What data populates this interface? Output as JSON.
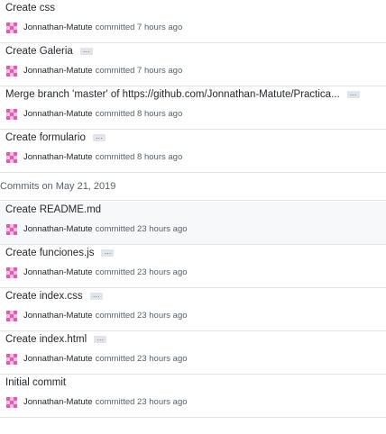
{
  "commits_top": [
    {
      "message": "Create css",
      "ellipsis": false,
      "author": "Jonnathan-Matute",
      "committed": "committed 7 hours ago"
    },
    {
      "message": "Create Galeria",
      "ellipsis": true,
      "author": "Jonnathan-Matute",
      "committed": "committed 7 hours ago"
    },
    {
      "message": "Merge branch 'master' of https://github.com/Jonnathan-Matute/Practica...",
      "ellipsis": true,
      "author": "Jonnathan-Matute",
      "committed": "committed 8 hours ago"
    },
    {
      "message": "Create formulario",
      "ellipsis": true,
      "author": "Jonnathan-Matute",
      "committed": "committed 8 hours ago"
    }
  ],
  "group_header": "Commits on May 21, 2019",
  "commits_bottom": [
    {
      "message": "Create README.md",
      "ellipsis": false,
      "author": "Jonnathan-Matute",
      "committed": "committed 23 hours ago"
    },
    {
      "message": "Create funciones.js",
      "ellipsis": true,
      "author": "Jonnathan-Matute",
      "committed": "committed 23 hours ago"
    },
    {
      "message": "Create index.css",
      "ellipsis": true,
      "author": "Jonnathan-Matute",
      "committed": "committed 23 hours ago"
    },
    {
      "message": "Create index.html",
      "ellipsis": true,
      "author": "Jonnathan-Matute",
      "committed": "committed 23 hours ago"
    },
    {
      "message": "Initial commit",
      "ellipsis": false,
      "author": "Jonnathan-Matute",
      "committed": "committed 23 hours ago"
    }
  ],
  "ellipsis_label": "…",
  "colors": {
    "avatar": "#e05cb4",
    "border": "#e1e4e8",
    "meta_text": "#586069"
  }
}
